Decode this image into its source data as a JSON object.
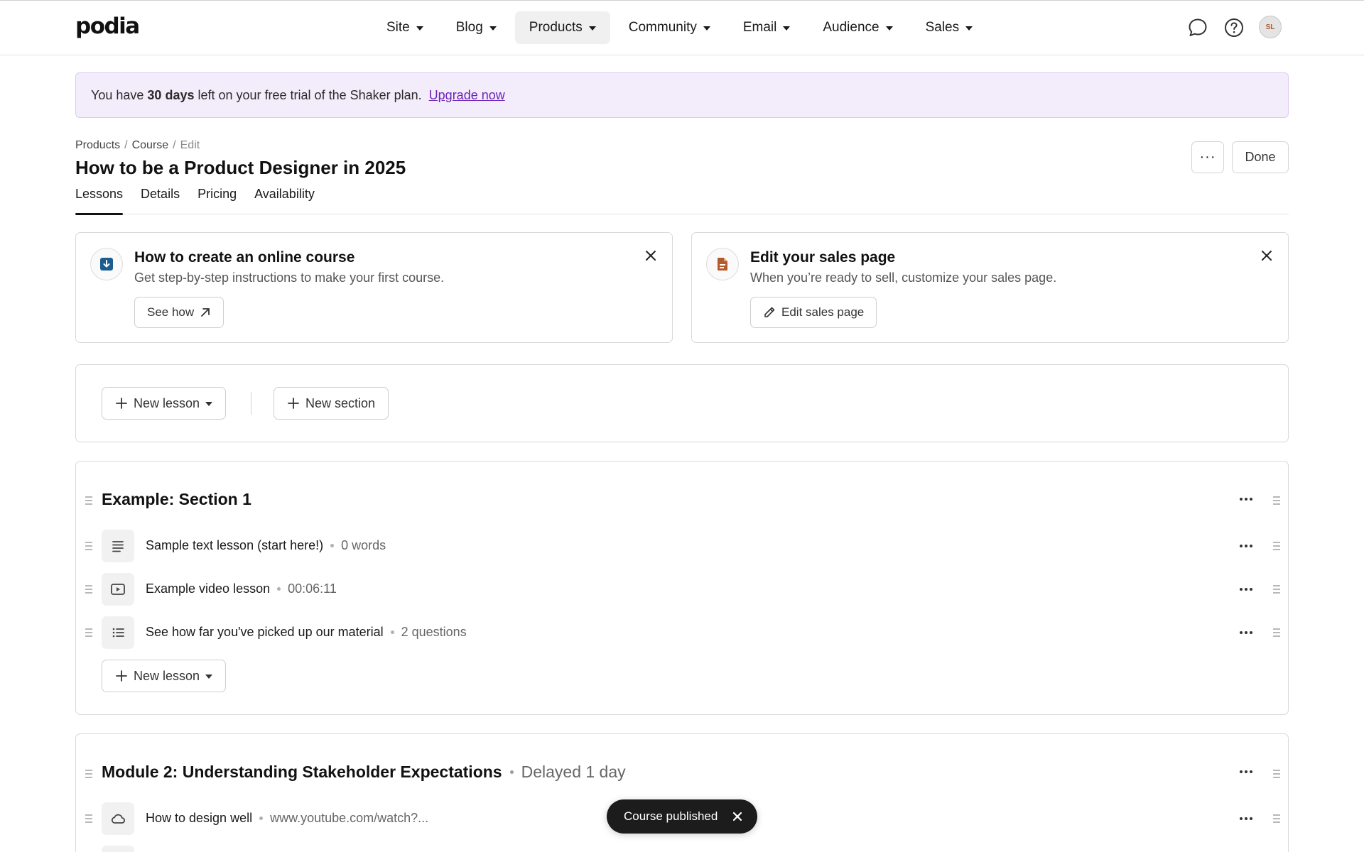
{
  "nav": {
    "logo": "podia",
    "items": [
      {
        "label": "Site"
      },
      {
        "label": "Blog"
      },
      {
        "label": "Products"
      },
      {
        "label": "Community"
      },
      {
        "label": "Email"
      },
      {
        "label": "Audience"
      },
      {
        "label": "Sales"
      }
    ],
    "active": "Products",
    "chat_icon": "chat-bubble-icon",
    "help_icon": "help-circle-icon",
    "avatar_initials": "SL"
  },
  "trial_banner": {
    "prefix": "You have",
    "days": "30 days",
    "suffix": "left on your free trial of the Shaker plan.",
    "link": "Upgrade now",
    "bg_color": "#f3ecfb",
    "link_color": "#6b22b8"
  },
  "breadcrumb": {
    "items": [
      "Products",
      "Course"
    ],
    "current": "Edit",
    "separator": "/"
  },
  "page": {
    "title": "How to be a Product Designer in 2025",
    "more_label": "···",
    "done_label": "Done"
  },
  "tabs": [
    {
      "label": "Lessons"
    },
    {
      "label": "Details"
    },
    {
      "label": "Pricing"
    },
    {
      "label": "Availability"
    }
  ],
  "active_tab": "Lessons",
  "cards": [
    {
      "title": "How to create an online course",
      "description": "Get step-by-step instructions to make your first course.",
      "button": "See how",
      "icon": "download-icon",
      "icon_color": "#1a5d8f"
    },
    {
      "title": "Edit your sales page",
      "description": "When you’re ready to sell, customize your sales page.",
      "button": "Edit sales page",
      "icon": "document-icon",
      "icon_color": "#b45a2c"
    }
  ],
  "actions": {
    "new_lesson": "New lesson",
    "new_section": "New section"
  },
  "sections": [
    {
      "title": "Example: Section 1",
      "delay": "",
      "lessons": [
        {
          "title": "Sample text lesson (start here!)",
          "meta": "0 words",
          "icon": "text-lines-icon"
        },
        {
          "title": "Example video lesson",
          "meta": "00:06:11",
          "icon": "video-play-icon"
        },
        {
          "title": "See how far you've picked up our material",
          "meta": "2 questions",
          "icon": "quiz-list-icon"
        }
      ],
      "new_lesson": "New lesson"
    },
    {
      "title": "Module 2: Understanding Stakeholder Expectations",
      "delay": "Delayed 1 day",
      "lessons": [
        {
          "title": "How to design well",
          "meta": "www.youtube.com/watch?...",
          "icon": "cloud-embed-icon"
        }
      ]
    }
  ],
  "toast": {
    "message": "Course published"
  }
}
